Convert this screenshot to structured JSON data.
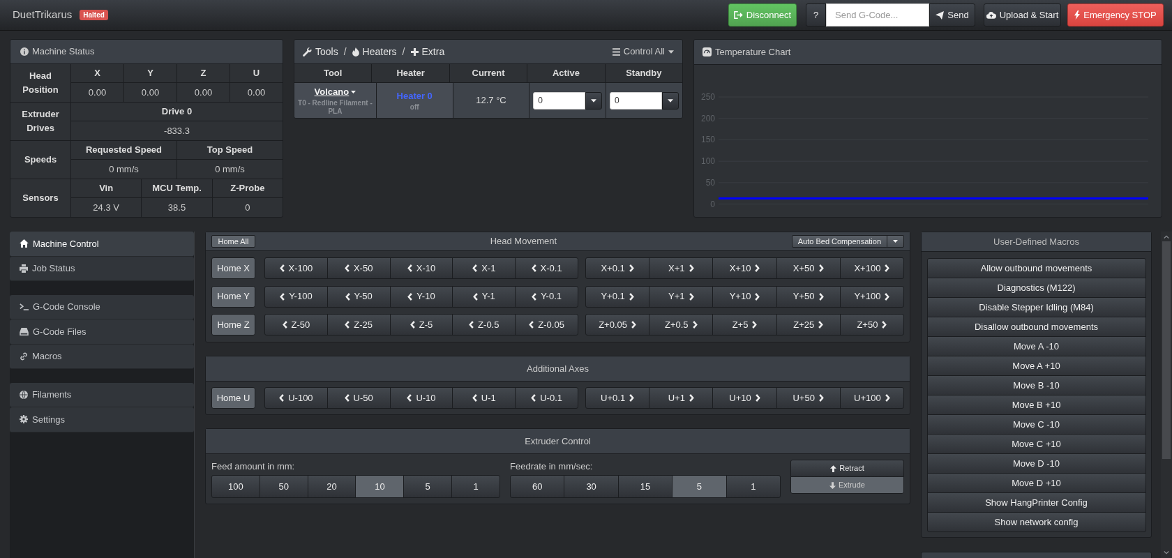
{
  "navbar": {
    "title": "DuetTrikarus",
    "status": "Halted",
    "disconnect_button": "Disconnect",
    "help_button": "?",
    "gcode_input": {
      "placeholder": "Send G-Code..."
    },
    "send_button": "Send",
    "upload_button": "Upload & Start",
    "stop_button": "Emergency STOP"
  },
  "machine_status": {
    "title": "Machine Status",
    "groups": [
      {
        "label": "Head Position",
        "columns": [
          {
            "heading": "X",
            "value": "0.00"
          },
          {
            "heading": "Y",
            "value": "0.00"
          },
          {
            "heading": "Z",
            "value": "0.00"
          },
          {
            "heading": "U",
            "value": "0.00"
          }
        ]
      },
      {
        "label": "Extruder Drives",
        "columns": [
          {
            "heading": "Drive 0",
            "value": "-833.3"
          }
        ]
      },
      {
        "label": "Speeds",
        "columns": [
          {
            "heading": "Requested Speed",
            "value": "0 mm/s"
          },
          {
            "heading": "Top Speed",
            "value": "0 mm/s"
          }
        ]
      },
      {
        "label": "Sensors",
        "columns": [
          {
            "heading": "Vin",
            "value": "24.3 V"
          },
          {
            "heading": "MCU Temp.",
            "value": "38.5"
          },
          {
            "heading": "Z-Probe",
            "value": "0"
          }
        ]
      }
    ]
  },
  "tools_panel": {
    "links": [
      {
        "label": "Tools"
      },
      {
        "label": "Heaters"
      },
      {
        "label": "Extra"
      }
    ],
    "separators": [
      "/",
      "/"
    ],
    "control_all": "Control All",
    "columns": [
      "Tool",
      "Heater",
      "Current",
      "Active",
      "Standby"
    ],
    "rows": [
      {
        "tool": "Volcano",
        "tool_detail": "T0 - Redline Filament - PLA",
        "heater": "Heater 0",
        "color": "#4466ff",
        "heater_state": "off",
        "current": "12.7 °C",
        "active": {
          "value": "0"
        },
        "standby": {
          "value": "0"
        }
      }
    ]
  },
  "temperature_chart": {
    "title": "Temperature Chart",
    "chart_data": {
      "type": "line",
      "grid": true,
      "ylim": [
        0,
        250
      ],
      "yticks": [
        0,
        50,
        100,
        150,
        200,
        250
      ],
      "series": [
        {
          "color": "#0000ff",
          "values": [
            13,
            13,
            13,
            13,
            13,
            13,
            13,
            13
          ]
        }
      ]
    }
  },
  "sidebar": {
    "groups": [
      {
        "items": [
          {
            "label": "Machine Control",
            "selected": true
          },
          {
            "label": "Job Status",
            "selected": false
          }
        ]
      },
      {
        "items": [
          {
            "label": "G-Code Console",
            "selected": false
          },
          {
            "label": "G-Code Files",
            "selected": false
          },
          {
            "label": "Macros",
            "selected": false
          }
        ]
      },
      {
        "items": [
          {
            "label": "Filaments",
            "selected": false
          },
          {
            "label": "Settings",
            "selected": false
          }
        ]
      }
    ]
  },
  "head_movement": {
    "home_all_button": "Home All",
    "title": "Head Movement",
    "compensation_button": "Auto Bed Compensation",
    "rows": [
      {
        "home_button": "Home X",
        "decrease": [
          "X-100",
          "X-50",
          "X-10",
          "X-1",
          "X-0.1"
        ],
        "increase": [
          "X+0.1",
          "X+1",
          "X+10",
          "X+50",
          "X+100"
        ]
      },
      {
        "home_button": "Home Y",
        "decrease": [
          "Y-100",
          "Y-50",
          "Y-10",
          "Y-1",
          "Y-0.1"
        ],
        "increase": [
          "Y+0.1",
          "Y+1",
          "Y+10",
          "Y+50",
          "Y+100"
        ]
      },
      {
        "home_button": "Home Z",
        "decrease": [
          "Z-50",
          "Z-25",
          "Z-5",
          "Z-0.5",
          "Z-0.05"
        ],
        "increase": [
          "Z+0.05",
          "Z+0.5",
          "Z+5",
          "Z+25",
          "Z+50"
        ]
      }
    ]
  },
  "additional_axes": {
    "title": "Additional Axes",
    "rows": [
      {
        "home_button": "Home U",
        "decrease": [
          "U-100",
          "U-50",
          "U-10",
          "U-1",
          "U-0.1"
        ],
        "increase": [
          "U+0.1",
          "U+1",
          "U+10",
          "U+50",
          "U+100"
        ]
      }
    ]
  },
  "extruder_control": {
    "title": "Extruder Control",
    "feed_amount": {
      "label": "Feed amount in mm:",
      "options": [
        {
          "label": "100",
          "selected": false
        },
        {
          "label": "50",
          "selected": false
        },
        {
          "label": "20",
          "selected": false
        },
        {
          "label": "10",
          "selected": true
        },
        {
          "label": "5",
          "selected": false
        },
        {
          "label": "1",
          "selected": false
        }
      ]
    },
    "feedrate": {
      "label": "Feedrate in mm/sec:",
      "options": [
        {
          "label": "60",
          "selected": false
        },
        {
          "label": "30",
          "selected": false
        },
        {
          "label": "15",
          "selected": false
        },
        {
          "label": "5",
          "selected": true
        },
        {
          "label": "1",
          "selected": false
        }
      ]
    },
    "actions": [
      {
        "label": "Retract",
        "active": false
      },
      {
        "label": "Extrude",
        "active": true
      }
    ]
  },
  "macros": {
    "title": "User-Defined Macros",
    "items": [
      "Allow outbound movements",
      "Diagnostics (M122)",
      "Disable Stepper Idling (M84)",
      "Disallow outbound movements",
      "Move A -10",
      "Move A +10",
      "Move B -10",
      "Move B +10",
      "Move C -10",
      "Move C +10",
      "Move D -10",
      "Move D +10",
      "Show HangPrinter Config",
      "Show network config"
    ]
  }
}
